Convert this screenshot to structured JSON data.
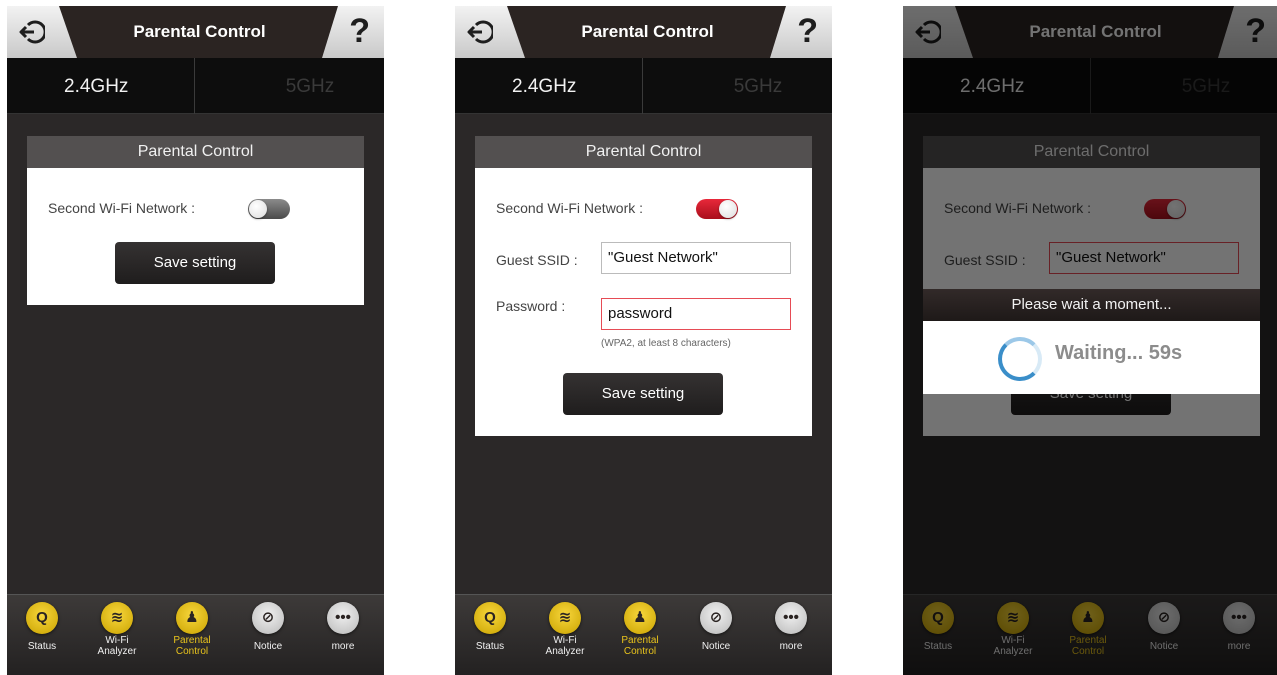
{
  "header": {
    "title": "Parental Control",
    "help_label": "?"
  },
  "tabs": {
    "band_a": "2.4GHz",
    "band_b": "5GHz"
  },
  "card": {
    "title": "Parental Control",
    "second_wifi_label": "Second Wi-Fi Network :",
    "guest_ssid_label": "Guest SSID :",
    "guest_ssid_value": "\"Guest Network\"",
    "password_label": "Password :",
    "password_value": "password",
    "password_hint": "(WPA2, at least 8 characters)",
    "save_label": "Save setting"
  },
  "screens": [
    {
      "second_wifi_enabled": false
    },
    {
      "second_wifi_enabled": true
    },
    {
      "second_wifi_enabled": true,
      "loading": true
    }
  ],
  "dialog": {
    "title": "Please wait a moment...",
    "waiting_text": "Waiting... 59s"
  },
  "nav": {
    "items": [
      {
        "label": "Status",
        "icon": "status-icon"
      },
      {
        "label": "Wi-Fi Analyzer",
        "icon": "wifi-icon"
      },
      {
        "label": "Parental Control",
        "icon": "parental-icon",
        "active": true
      },
      {
        "label": "Notice",
        "icon": "notice-icon"
      },
      {
        "label": "more",
        "icon": "more-icon"
      }
    ]
  },
  "colors": {
    "accent": "#e8c31c",
    "toggle_on": "#d81e2e",
    "error_border": "#e64b55"
  }
}
